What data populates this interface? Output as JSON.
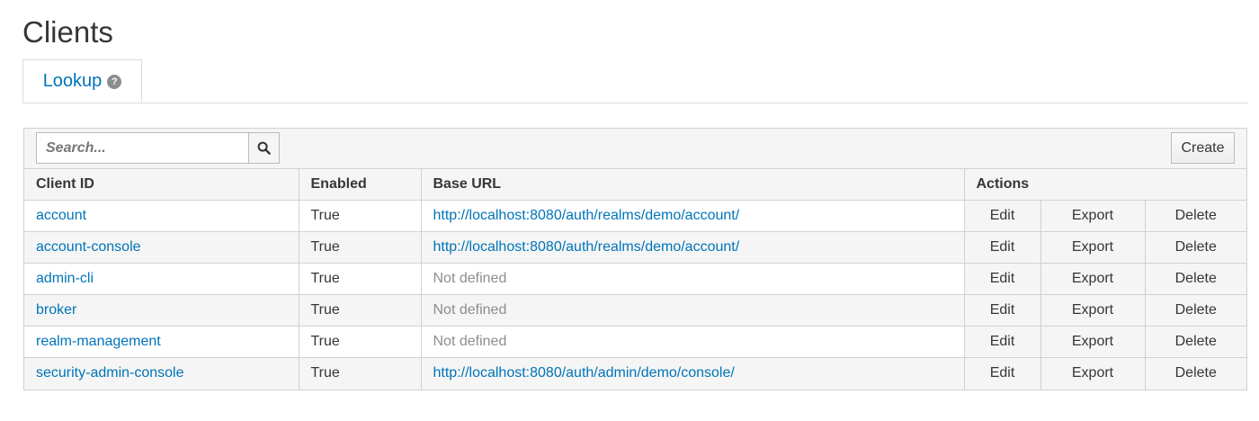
{
  "page": {
    "title": "Clients"
  },
  "tabs": [
    {
      "label": "Lookup",
      "help_icon": "question-circle-icon"
    }
  ],
  "toolbar": {
    "search_placeholder": "Search...",
    "search_icon": "search-icon",
    "create_label": "Create"
  },
  "table": {
    "columns": [
      "Client ID",
      "Enabled",
      "Base URL",
      "Actions"
    ],
    "actions": [
      "Edit",
      "Export",
      "Delete"
    ],
    "rows": [
      {
        "client_id": "account",
        "enabled": "True",
        "base_url": "http://localhost:8080/auth/realms/demo/account/",
        "url_defined": true
      },
      {
        "client_id": "account-console",
        "enabled": "True",
        "base_url": "http://localhost:8080/auth/realms/demo/account/",
        "url_defined": true
      },
      {
        "client_id": "admin-cli",
        "enabled": "True",
        "base_url": "Not defined",
        "url_defined": false
      },
      {
        "client_id": "broker",
        "enabled": "True",
        "base_url": "Not defined",
        "url_defined": false
      },
      {
        "client_id": "realm-management",
        "enabled": "True",
        "base_url": "Not defined",
        "url_defined": false
      },
      {
        "client_id": "security-admin-console",
        "enabled": "True",
        "base_url": "http://localhost:8080/auth/admin/demo/console/",
        "url_defined": true
      }
    ]
  },
  "colors": {
    "link": "#0074b8",
    "muted": "#8b8d8f",
    "border": "#d1d1d1",
    "header_bg": "#f5f5f5"
  }
}
